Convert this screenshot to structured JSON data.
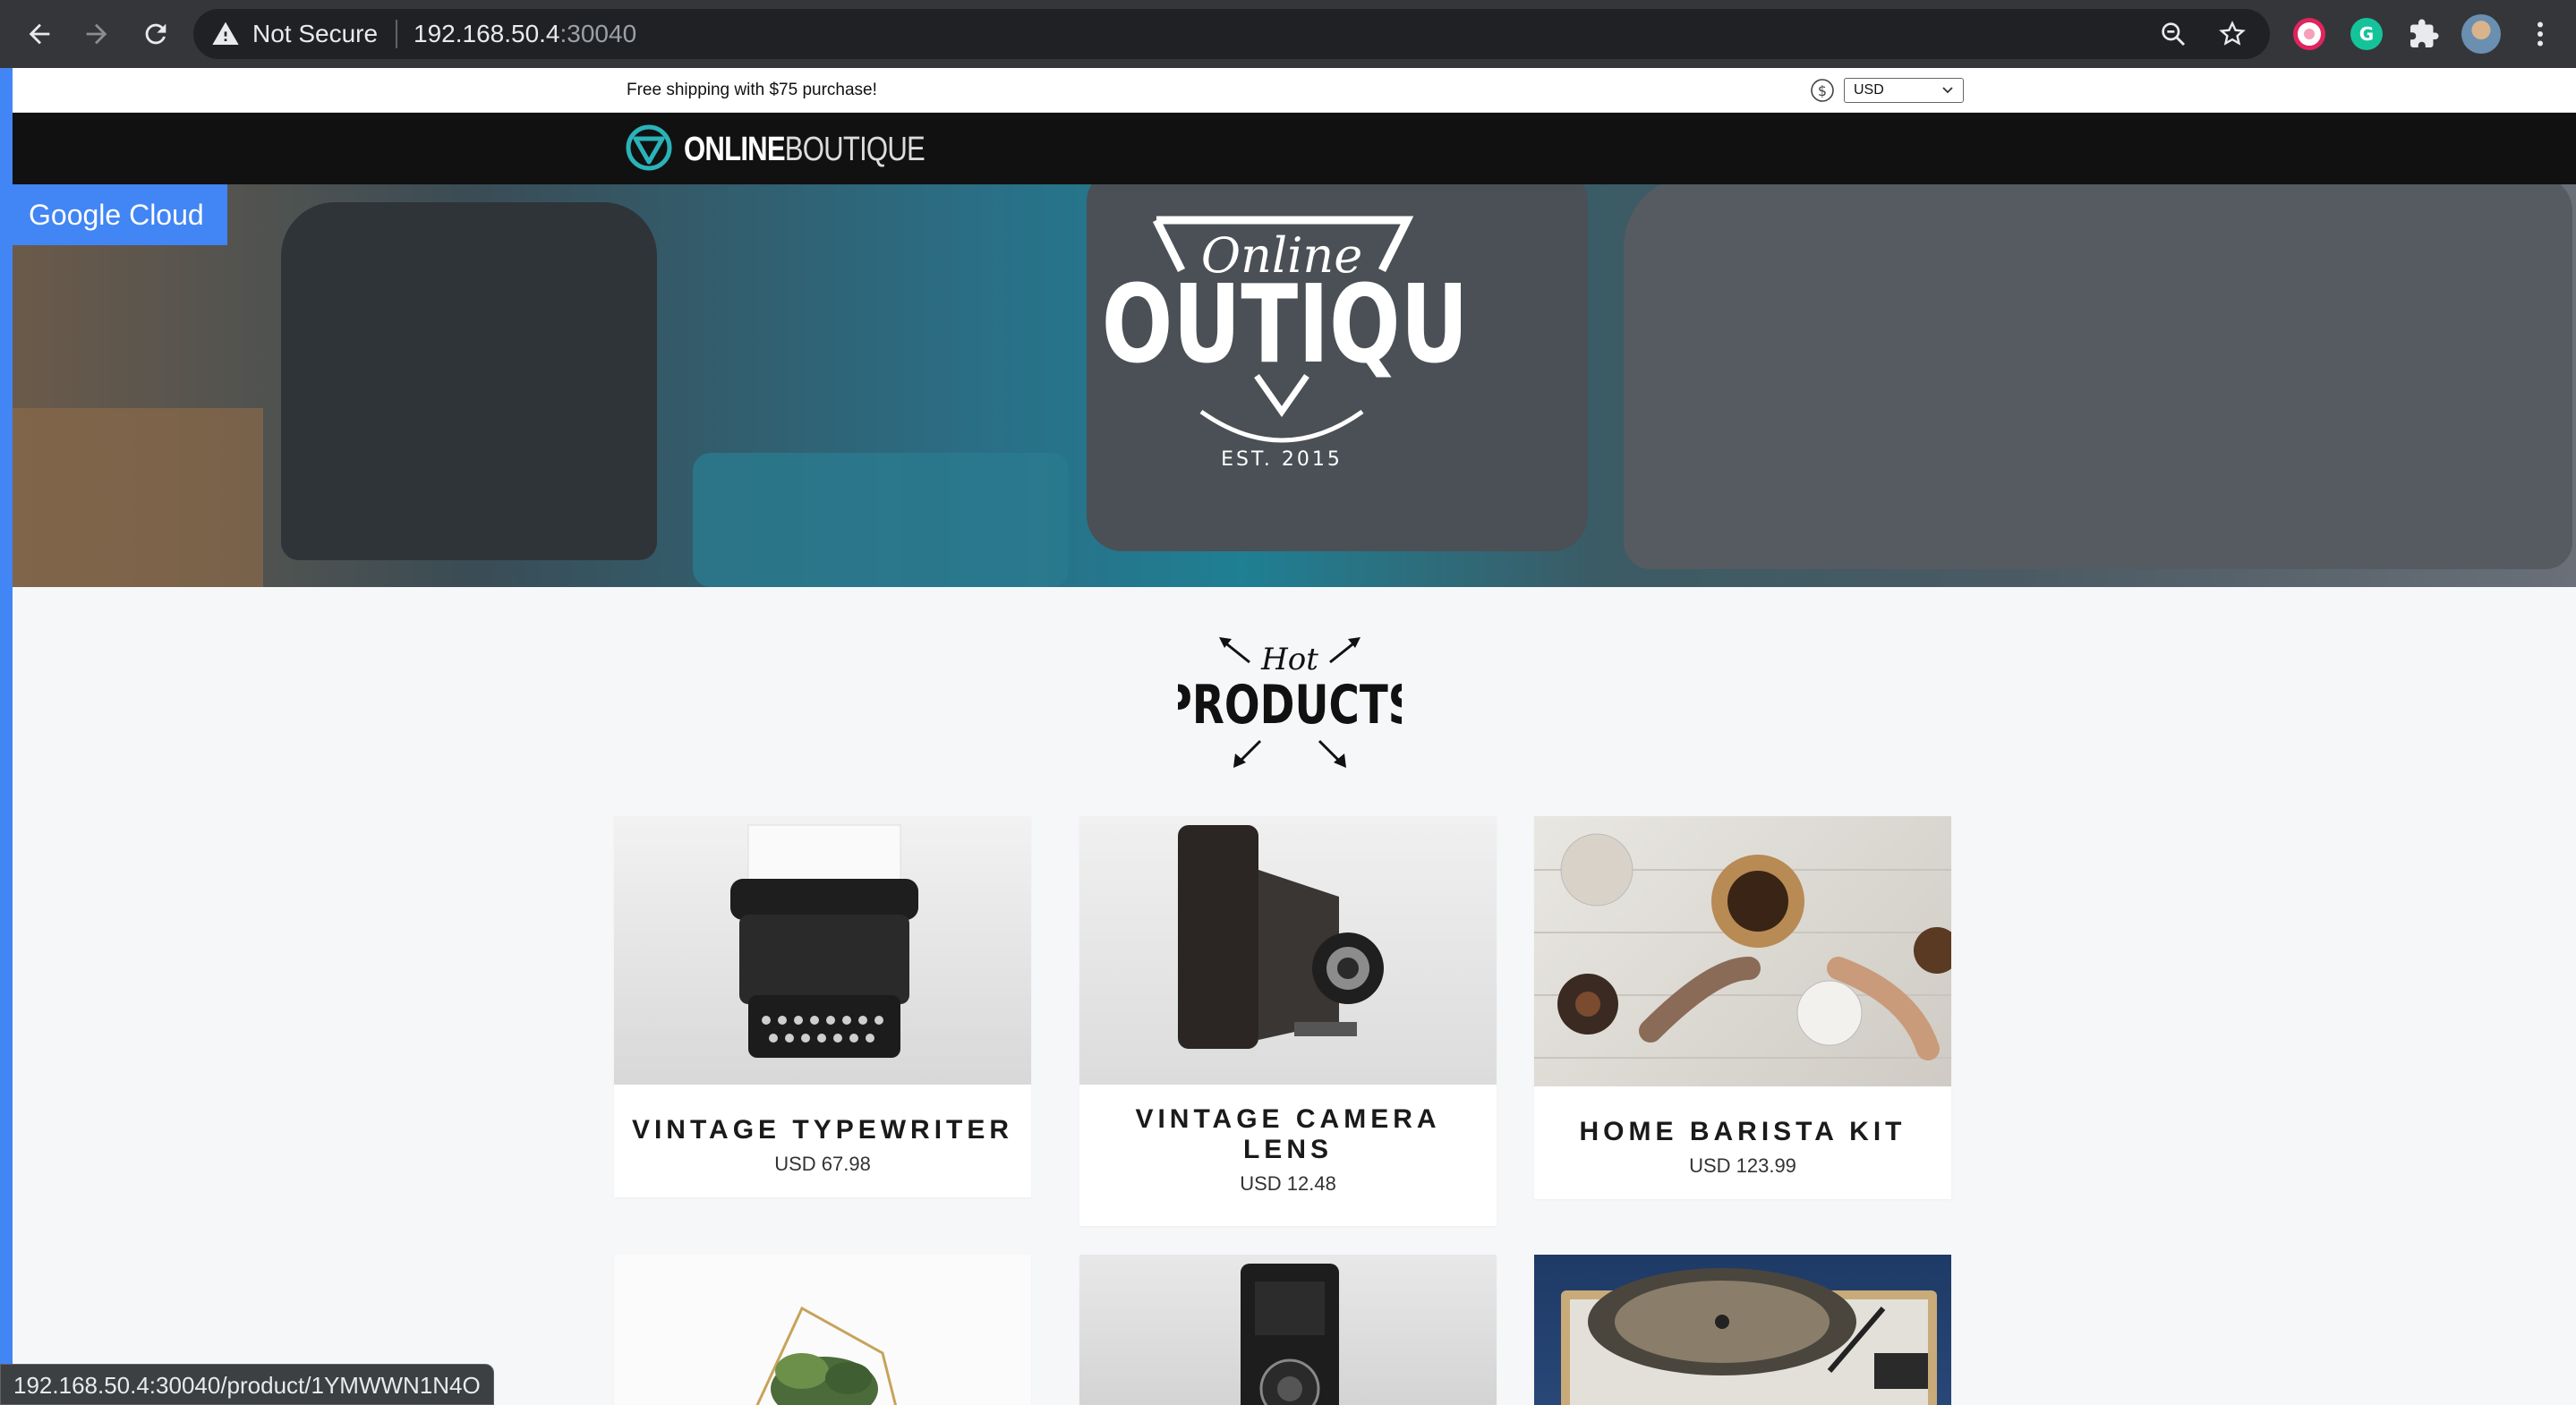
{
  "browser": {
    "security_label": "Not Secure",
    "url_host": "192.168.50.4",
    "url_port": ":30040"
  },
  "topbar": {
    "shipping_text": "Free shipping with $75 purchase!",
    "currency_selected": "USD"
  },
  "header": {
    "logo_bold": "ONLINE",
    "logo_light": "BOUTIQUE"
  },
  "hero": {
    "badge": "Google Cloud",
    "logo_script": "Online",
    "logo_main": "BOUTIQUE",
    "logo_est": "EST. 2015"
  },
  "hot_products": {
    "script": "Hot",
    "main": "PRODUCTS"
  },
  "products": [
    {
      "name": "VINTAGE TYPEWRITER",
      "price": "USD 67.98"
    },
    {
      "name": "VINTAGE CAMERA LENS",
      "name_line1": "VINTAGE CAMERA",
      "name_line2": "LENS",
      "price": "USD 12.48"
    },
    {
      "name": "HOME BARISTA KIT",
      "price": "USD 123.99"
    }
  ],
  "status_bar": {
    "link_url": "192.168.50.4:30040/product/1YMWWN1N4O"
  },
  "colors": {
    "accent_blue": "#4285f4",
    "header_black": "#111111",
    "logo_teal": "#2ab3b8",
    "page_bg": "#f6f7f9"
  }
}
